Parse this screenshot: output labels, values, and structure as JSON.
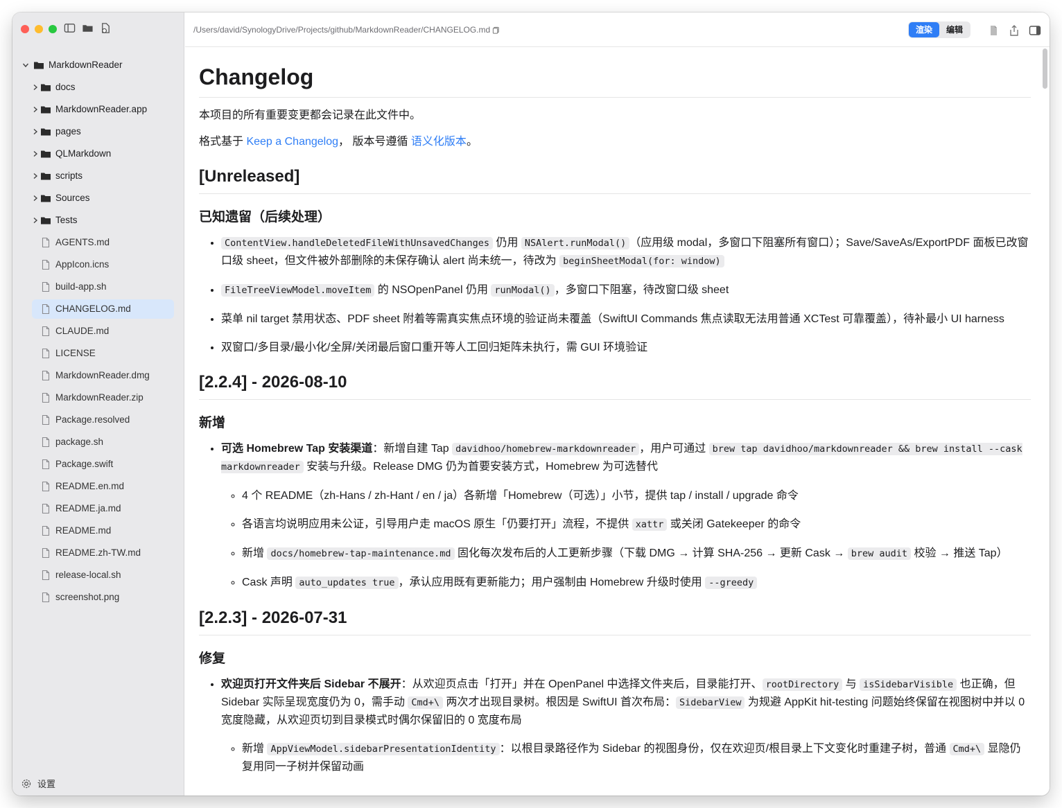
{
  "path": "/Users/david/SynologyDrive/Projects/github/MarkdownReader/CHANGELOG.md",
  "view_mode": {
    "render": "渲染",
    "edit": "编辑"
  },
  "settings_label": "设置",
  "tree": {
    "root": "MarkdownReader",
    "folders": [
      "docs",
      "MarkdownReader.app",
      "pages",
      "QLMarkdown",
      "scripts",
      "Sources",
      "Tests"
    ],
    "files": [
      "AGENTS.md",
      "AppIcon.icns",
      "build-app.sh",
      "CHANGELOG.md",
      "CLAUDE.md",
      "LICENSE",
      "MarkdownReader.dmg",
      "MarkdownReader.zip",
      "Package.resolved",
      "package.sh",
      "Package.swift",
      "README.en.md",
      "README.ja.md",
      "README.md",
      "README.zh-TW.md",
      "release-local.sh",
      "screenshot.png"
    ],
    "selected": "CHANGELOG.md"
  },
  "doc": {
    "title": "Changelog",
    "intro": "本项目的所有重要变更都会记录在此文件中。",
    "format_pre": "格式基于 ",
    "link_keep": "Keep a Changelog",
    "format_mid": "， 版本号遵循 ",
    "link_semver": "语义化版本",
    "format_end": "。",
    "unreleased": {
      "heading": "[Unreleased]",
      "sub": "已知遗留（后续处理）",
      "i1_c1": "ContentView.handleDeletedFileWithUnsavedChanges",
      "i1_t1": " 仍用 ",
      "i1_c2": "NSAlert.runModal()",
      "i1_t2": "（应用级 modal，多窗口下阻塞所有窗口）；Save/SaveAs/ExportPDF 面板已改窗口级 sheet，但文件被外部删除的未保存确认 alert 尚未统一，待改为 ",
      "i1_c3": "beginSheetModal(for: window)",
      "i2_c1": "FileTreeViewModel.moveItem",
      "i2_t1": " 的 NSOpenPanel 仍用 ",
      "i2_c2": "runModal()",
      "i2_t2": "，多窗口下阻塞，待改窗口级 sheet",
      "i3": "菜单 nil target 禁用状态、PDF sheet 附着等需真实焦点环境的验证尚未覆盖（SwiftUI Commands 焦点读取无法用普通 XCTest 可靠覆盖），待补最小 UI harness",
      "i4": "双窗口/多目录/最小化/全屏/关闭最后窗口重开等人工回归矩阵未执行，需 GUI 环境验证"
    },
    "v224": {
      "heading": "[2.2.4] - 2026-08-10",
      "sub": "新增",
      "main_bold": "可选 Homebrew Tap 安装渠道",
      "main_t1": "：新增自建 Tap ",
      "main_c1": "davidhoo/homebrew-markdownreader",
      "main_t2": "，用户可通过 ",
      "main_c2": "brew tap davidhoo/markdownreader && brew install --cask markdownreader",
      "main_t3": " 安装与升级。Release DMG 仍为首要安装方式，Homebrew 为可选替代",
      "s1": "4 个 README（zh-Hans / zh-Hant / en / ja）各新增「Homebrew（可选）」小节，提供 tap / install / upgrade 命令",
      "s2_t1": "各语言均说明应用未公证，引导用户走 macOS 原生「仍要打开」流程，不提供 ",
      "s2_c1": "xattr",
      "s2_t2": " 或关闭 Gatekeeper 的命令",
      "s3_t1": "新增 ",
      "s3_c1": "docs/homebrew-tap-maintenance.md",
      "s3_t2": " 固化每次发布后的人工更新步骤（下载 DMG → 计算 SHA-256 → 更新 Cask → ",
      "s3_c2": "brew audit",
      "s3_t3": " 校验 → 推送 Tap）",
      "s4_t1": "Cask 声明 ",
      "s4_c1": "auto_updates true",
      "s4_t2": "，承认应用既有更新能力；用户强制由 Homebrew 升级时使用 ",
      "s4_c2": "--greedy"
    },
    "v223": {
      "heading": "[2.2.3] - 2026-07-31",
      "sub": "修复",
      "main_bold": "欢迎页打开文件夹后 Sidebar 不展开",
      "main_t1": "：从欢迎页点击「打开」并在 OpenPanel 中选择文件夹后，目录能打开、",
      "main_c1": "rootDirectory",
      "main_t2": " 与 ",
      "main_c2": "isSidebarVisible",
      "main_t3": " 也正确，但 Sidebar 实际呈现宽度仍为 0，需手动 ",
      "main_c3": "Cmd+\\",
      "main_t4": " 两次才出现目录树。根因是 SwiftUI 首次布局：",
      "main_c4": "SidebarView",
      "main_t5": " 为规避 AppKit hit-testing 问题始终保留在视图树中并以 0 宽度隐藏，从欢迎页切到目录模式时偶尔保留旧的 0 宽度布局",
      "s1_t1": "新增 ",
      "s1_c1": "AppViewModel.sidebarPresentationIdentity",
      "s1_t2": "：以根目录路径作为 Sidebar 的视图身份，仅在欢迎页/根目录上下文变化时重建子树，普通 ",
      "s1_c2": "Cmd+\\",
      "s1_t3": " 显隐仍复用同一子树并保留动画"
    }
  }
}
